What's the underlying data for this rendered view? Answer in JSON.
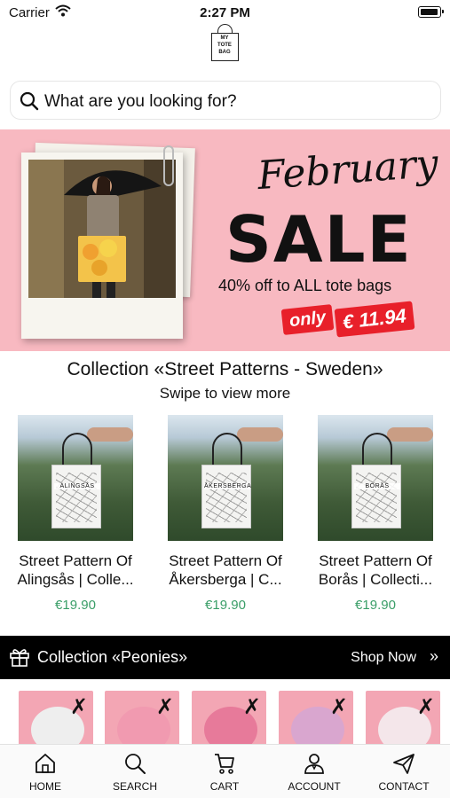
{
  "status_bar": {
    "carrier": "Carrier",
    "time": "2:27 PM"
  },
  "logo": {
    "line1": "MY",
    "line2": "TOTE",
    "line3": "BAG"
  },
  "search": {
    "placeholder": "What are you looking for?"
  },
  "banner": {
    "script": "February",
    "headline": "SALE",
    "subtitle": "40% off to ALL tote bags",
    "only_label": "only",
    "price": "€ 11.94",
    "background": "#f8b9c1"
  },
  "collection": {
    "title": "Collection «Street Patterns - Sweden»",
    "subtitle": "Swipe to view more",
    "products": [
      {
        "city_print": "ALINGSÅS",
        "name_line1": "Street Pattern Of",
        "name_line2": "Alingsås | Colle...",
        "price": "€19.90"
      },
      {
        "city_print": "ÅKERSBERGA",
        "name_line1": "Street Pattern Of",
        "name_line2": "Åkersberga | C...",
        "price": "€19.90"
      },
      {
        "city_print": "BORÅS",
        "name_line1": "Street Pattern Of",
        "name_line2": "Borås | Collecti...",
        "price": "€19.90"
      }
    ]
  },
  "peonies": {
    "title": "Collection «Peonies»",
    "shop_now": "Shop Now",
    "arrow": "»"
  },
  "tabbar": {
    "items": [
      {
        "label": "HOME",
        "icon": "home-icon"
      },
      {
        "label": "SEARCH",
        "icon": "search-icon"
      },
      {
        "label": "CART",
        "icon": "cart-icon"
      },
      {
        "label": "ACCOUNT",
        "icon": "account-icon"
      },
      {
        "label": "CONTACT",
        "icon": "send-icon"
      }
    ]
  },
  "colors": {
    "price_green": "#3a9e68",
    "sale_red": "#e8202a"
  }
}
